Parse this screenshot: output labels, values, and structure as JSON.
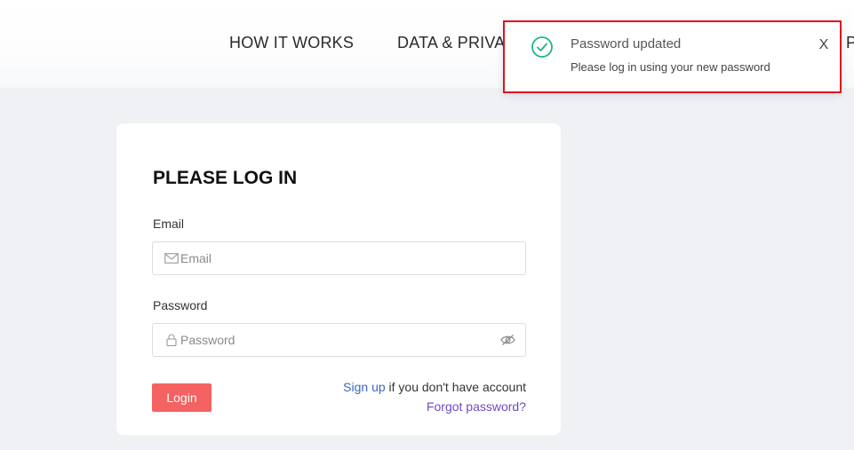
{
  "header": {
    "nav": [
      {
        "label": "HOW IT WORKS"
      },
      {
        "label": "DATA & PRIVA"
      },
      {
        "label": "P"
      }
    ]
  },
  "toast": {
    "title": "Password updated",
    "message": "Please log in using your new password",
    "close_label": "X",
    "icon": "check-circle-icon",
    "accent_color": "#1bb58a",
    "highlight_border_color": "#e0121d"
  },
  "login": {
    "title": "PLEASE LOG IN",
    "email_label": "Email",
    "email_placeholder": "Email",
    "email_value": "",
    "password_label": "Password",
    "password_placeholder": "Password",
    "password_value": "",
    "login_button_label": "Login",
    "signup_link_label": "Sign up",
    "signup_suffix": " if you don't have account",
    "forgot_link_label": "Forgot password?",
    "button_color": "#f46262",
    "link_color": "#3e64c8",
    "forgot_color": "#6f4ac4"
  }
}
